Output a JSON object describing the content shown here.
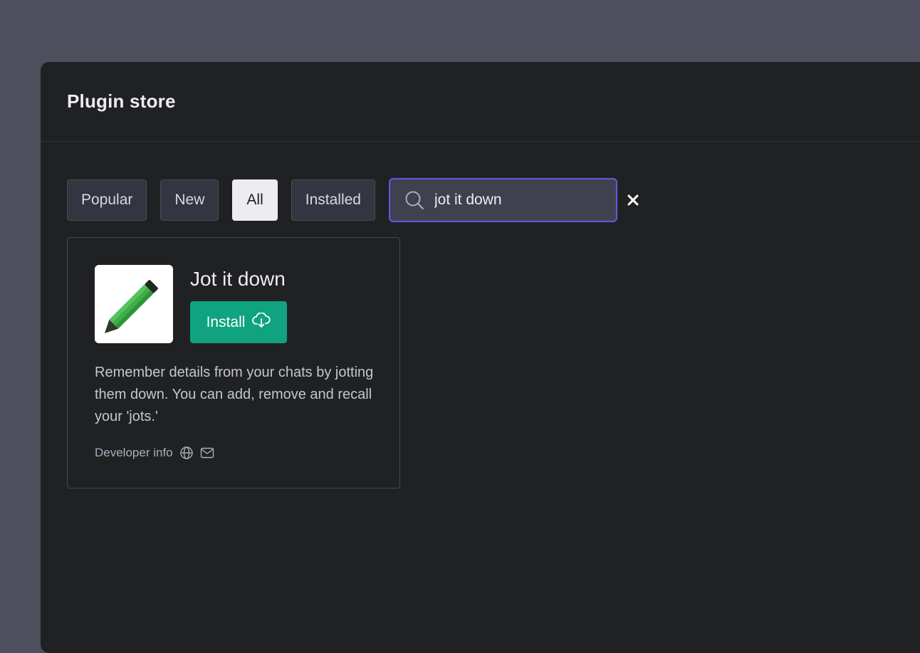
{
  "modal": {
    "title": "Plugin store"
  },
  "filters": {
    "tabs": [
      {
        "label": "Popular",
        "active": false
      },
      {
        "label": "New",
        "active": false
      },
      {
        "label": "All",
        "active": true
      },
      {
        "label": "Installed",
        "active": false
      }
    ]
  },
  "search": {
    "value": "jot it down",
    "icon": "search-icon",
    "clear_icon": "close-icon"
  },
  "plugin": {
    "name": "Jot it down",
    "install_label": "Install",
    "install_icon": "cloud-download-icon",
    "description": "Remember details from your chats by jotting them down. You can add, remove and recall your 'jots.'",
    "developer_label": "Developer info",
    "developer_icons": [
      "globe-icon",
      "mail-icon"
    ],
    "logo": "pencil-logo"
  },
  "colors": {
    "accent": "#10a37f",
    "focus_ring": "#6259e6",
    "modal_bg": "#202123",
    "backdrop": "#4d4f5d"
  }
}
